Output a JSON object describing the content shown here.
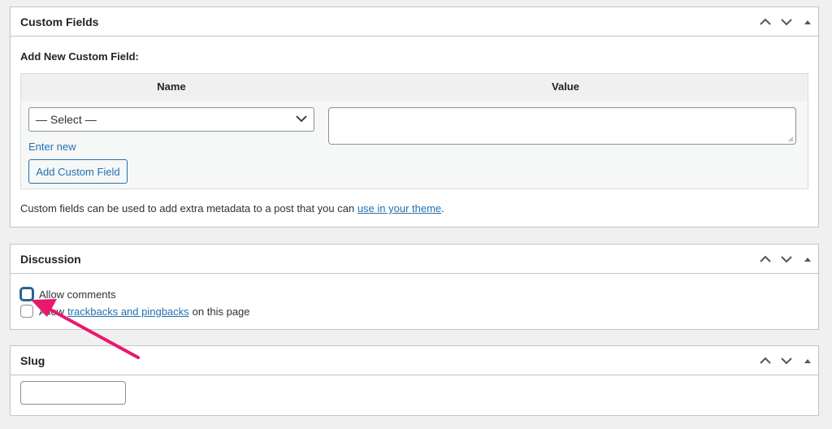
{
  "custom_fields": {
    "title": "Custom Fields",
    "heading": "Add New Custom Field:",
    "col_name": "Name",
    "col_value": "Value",
    "select_value": "— Select —",
    "enter_new": "Enter new",
    "add_button": "Add Custom Field",
    "description_prefix": "Custom fields can be used to add extra metadata to a post that you can ",
    "description_link": "use in your theme",
    "description_suffix": "."
  },
  "discussion": {
    "title": "Discussion",
    "allow_comments": "Allow comments",
    "allow_prefix": "Allow",
    "trackbacks_link": "trackbacks and pingbacks",
    "trackbacks_suffix": "on this page"
  },
  "slug": {
    "title": "Slug",
    "value": ""
  },
  "icons": {
    "move_up": "chevron-up-icon",
    "move_down": "chevron-down-icon",
    "toggle": "triangle-up-icon",
    "select_arrow": "chevron-down-icon",
    "annotation": "arrow-annotation"
  },
  "colors": {
    "link": "#2271b1",
    "border": "#c3c4c7",
    "annotation_arrow": "#e8186d"
  }
}
